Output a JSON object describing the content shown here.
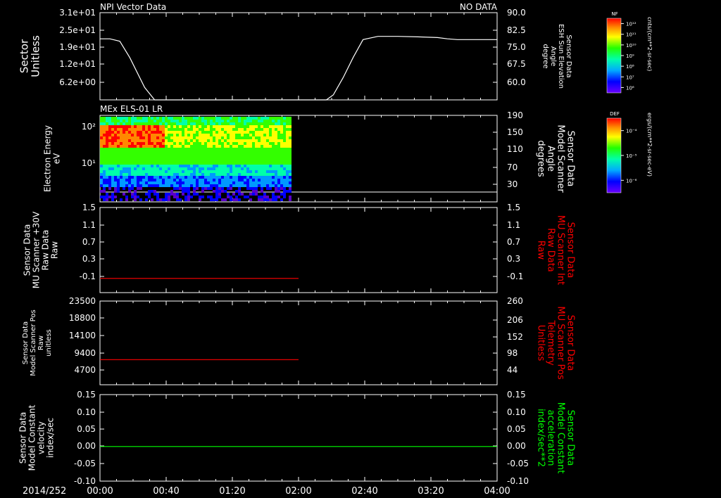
{
  "footer": {
    "date_label": "2014/252"
  },
  "time_axis": {
    "start_hour": 0,
    "end_hour": 4,
    "tick_labels": [
      "00:00",
      "00:40",
      "01:20",
      "02:00",
      "02:40",
      "03:20",
      "04:00"
    ],
    "tick_hours": [
      0,
      0.6667,
      1.3333,
      2.0,
      2.6667,
      3.3333,
      4.0
    ]
  },
  "colors": {
    "red": "#ff0000",
    "green": "#00ff00",
    "white": "#ffffff"
  },
  "panels": [
    {
      "title": "NPI Vector Data",
      "status": "NO DATA",
      "left_label": [
        "Sector",
        "Unitless"
      ],
      "left_ticks": [
        "3.1e+01",
        "2.5e+01",
        "1.9e+01",
        "1.2e+01",
        "6.2e+00"
      ],
      "right_label": [
        "Sensor Data",
        "ESH Sun Elevation",
        "Angle",
        "degree"
      ],
      "right_ticks": [
        "90.0",
        "82.5",
        "75.0",
        "67.5",
        "60.0"
      ],
      "right_range": [
        55,
        90
      ]
    },
    {
      "title": "MEx ELS-01 LR",
      "left_label": [
        "Electron Energy",
        "eV"
      ],
      "left_ticks": [
        "10²",
        "10¹"
      ],
      "right_label": [
        "Sensor Data",
        "Model Scanner",
        "Angle",
        "degrees"
      ],
      "right_ticks": [
        "190",
        "150",
        "110",
        "70",
        "30"
      ],
      "right_range": [
        10,
        190
      ]
    },
    {
      "left_label": [
        "Sensor Data",
        "MU Scanner +30V",
        "Raw Data",
        "Raw"
      ],
      "left_ticks": [
        "1.5",
        "1.1",
        "0.7",
        "0.3",
        "-0.1"
      ],
      "left_range": [
        -0.3,
        1.5
      ],
      "right_label": [
        "Sensor Data",
        "MU Scanner Int",
        "Raw Data",
        "Raw"
      ],
      "right_ticks": [
        "1.5",
        "1.1",
        "0.7",
        "0.3",
        "-0.1"
      ]
    },
    {
      "left_label": [
        "Sensor Data",
        "Model Scanner Pos",
        "Raw",
        "unitless"
      ],
      "left_ticks": [
        "23500",
        "18800",
        "14100",
        "9400",
        "4700"
      ],
      "left_range": [
        0,
        23500
      ],
      "right_label": [
        "Sensor Data",
        "MU Scanner Pos",
        "Telemetry",
        "Unitless"
      ],
      "right_ticks": [
        "260",
        "206",
        "152",
        "98",
        "44"
      ]
    },
    {
      "left_label": [
        "Sensor Data",
        "Model Constant",
        "velocity",
        "index/sec"
      ],
      "left_ticks": [
        "0.15",
        "0.10",
        "0.05",
        "0.00",
        "-0.05",
        "-0.10"
      ],
      "left_range": [
        -0.1,
        0.15
      ],
      "right_label": [
        "Sensor Data",
        "Model Constant",
        "acceleration",
        "index/sec**2"
      ],
      "right_ticks": [
        "0.15",
        "0.10",
        "0.05",
        "0.00",
        "-0.05",
        "-0.10"
      ]
    }
  ],
  "colorbars": [
    {
      "name": "NF",
      "unit": "cnts/(cm**2-sr-sec)",
      "tick_labels": [
        "10¹²",
        "10¹¹",
        "10¹⁰",
        "10⁹",
        "10⁸",
        "10⁷",
        "10⁶"
      ]
    },
    {
      "name": "DEF",
      "unit": "ergs/(cm**2-sr-sec-eV)",
      "tick_labels": [
        "10⁻⁴",
        "10⁻⁵",
        "10⁻⁶"
      ]
    }
  ],
  "chart_data": [
    {
      "type": "line",
      "panel": 0,
      "series": [
        {
          "color": "#ffffff",
          "x": [
            0.0,
            0.1,
            0.2,
            0.3,
            0.45,
            0.55,
            0.6,
            2.2,
            2.28,
            2.35,
            2.45,
            2.55,
            2.65,
            2.8,
            3.0,
            3.2,
            3.4,
            3.5,
            3.6,
            4.0
          ],
          "y": [
            79.5,
            79.5,
            78.5,
            72,
            60,
            55,
            55,
            55,
            55,
            57,
            64,
            72,
            79.2,
            80.5,
            80.5,
            80.3,
            80.0,
            79.5,
            79.2,
            79.2
          ]
        }
      ]
    },
    {
      "type": "heatmap",
      "panel": 1,
      "x_range": [
        0,
        1.92
      ],
      "y_range_eV": [
        1.5,
        200
      ],
      "yscale": "log",
      "note": "omnidirectional energy-time spectrogram, DEF color scale"
    },
    {
      "type": "line",
      "panel": 2,
      "series": [
        {
          "color": "#ff0000",
          "x": [
            0,
            2.0
          ],
          "y": [
            0.0,
            0.0
          ]
        }
      ]
    },
    {
      "type": "line",
      "panel": 3,
      "series": [
        {
          "color": "#ff0000",
          "x": [
            0,
            2.0
          ],
          "y": [
            7050,
            7050
          ]
        }
      ]
    },
    {
      "type": "line",
      "panel": 4,
      "series": [
        {
          "color": "#00ff00",
          "x": [
            0,
            4.0
          ],
          "y": [
            0.0,
            0.0
          ]
        }
      ]
    }
  ]
}
